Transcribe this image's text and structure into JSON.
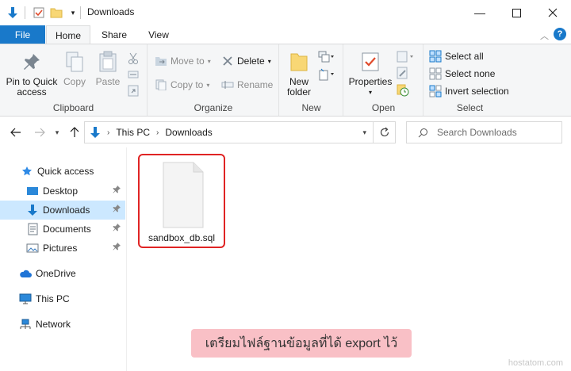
{
  "window": {
    "title": "Downloads"
  },
  "tabs": {
    "file": "File",
    "home": "Home",
    "share": "Share",
    "view": "View",
    "help": "?"
  },
  "ribbon": {
    "clipboard": {
      "label": "Clipboard",
      "pin_line1": "Pin to Quick",
      "pin_line2": "access",
      "copy": "Copy",
      "paste": "Paste"
    },
    "organize": {
      "label": "Organize",
      "move_to": "Move to",
      "copy_to": "Copy to",
      "delete": "Delete",
      "rename": "Rename"
    },
    "new": {
      "label": "New",
      "new_folder_line1": "New",
      "new_folder_line2": "folder"
    },
    "open": {
      "label": "Open",
      "properties": "Properties"
    },
    "select": {
      "label": "Select",
      "select_all": "Select all",
      "select_none": "Select none",
      "invert_selection": "Invert selection"
    }
  },
  "address": {
    "crumbs": [
      "This PC",
      "Downloads"
    ],
    "search_placeholder": "Search Downloads"
  },
  "navpane": {
    "items": [
      {
        "label": "Quick access",
        "icon": "star-icon"
      },
      {
        "label": "Desktop",
        "icon": "desktop-icon"
      },
      {
        "label": "Downloads",
        "icon": "download-icon"
      },
      {
        "label": "Documents",
        "icon": "documents-icon"
      },
      {
        "label": "Pictures",
        "icon": "pictures-icon"
      },
      {
        "label": "OneDrive",
        "icon": "cloud-icon"
      },
      {
        "label": "This PC",
        "icon": "computer-icon"
      },
      {
        "label": "Network",
        "icon": "network-icon"
      }
    ]
  },
  "content": {
    "file_name": "sandbox_db.sql",
    "caption": "เตรียมไฟล์ฐานข้อมูลที่ได้ export ไว้",
    "watermark": "hostatom.com"
  },
  "colors": {
    "accent": "#1979ca",
    "selection": "#cce8ff",
    "highlight_border": "#e02424",
    "caption_bg": "#f9c0c6"
  }
}
